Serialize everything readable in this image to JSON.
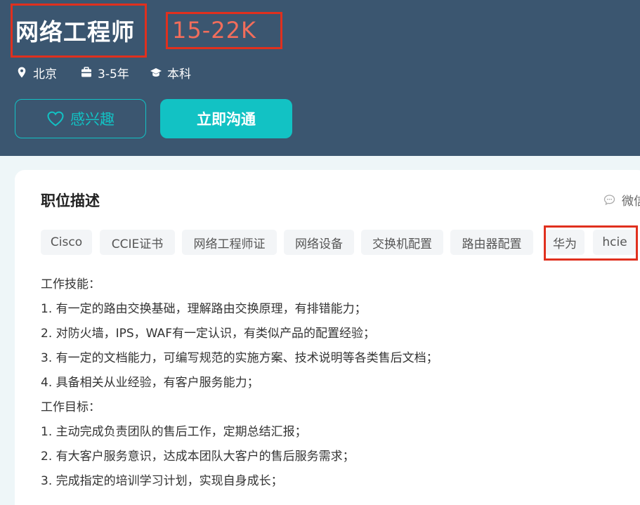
{
  "job": {
    "title": "网络工程师",
    "salary": "15-22K",
    "location": "北京",
    "experience": "3-5年",
    "education": "本科"
  },
  "actions": {
    "interest_label": "感兴趣",
    "chat_label": "立即沟通"
  },
  "section": {
    "title": "职位描述",
    "wechat_label": "微信"
  },
  "tags": [
    "Cisco",
    "CCIE证书",
    "网络工程师证",
    "网络设备",
    "交换机配置",
    "路由器配置",
    "华为",
    "hcie"
  ],
  "description": [
    "工作技能：",
    "1. 有一定的路由交换基础，理解路由交换原理，有排错能力；",
    "2. 对防火墙，IPS，WAF有一定认识，有类似产品的配置经验；",
    "3. 有一定的文档能力，可编写规范的实施方案、技术说明等各类售后文档；",
    "4. 具备相关从业经验，有客户服务能力；",
    "工作目标：",
    "1. 主动完成负责团队的售后工作，定期总结汇报；",
    "2. 有大客户服务意识，达成本团队大客户的售后服务需求；",
    "3. 完成指定的培训学习计划，实现自身成长；"
  ],
  "icons": {
    "location": "location-pin-icon",
    "experience": "briefcase-icon",
    "education": "graduation-cap-icon",
    "interest": "heart-icon",
    "wechat": "chat-bubble-icon"
  },
  "colors": {
    "header_bg": "#3b5670",
    "accent": "#12c2c4",
    "salary": "#f26d5b",
    "annotation": "#e0301e"
  }
}
